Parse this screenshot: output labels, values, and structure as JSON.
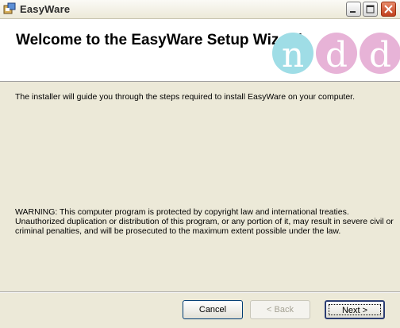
{
  "window": {
    "title": "EasyWare"
  },
  "header": {
    "title": "Welcome to the EasyWare Setup Wizard",
    "logo_letters": [
      "n",
      "d",
      "d"
    ]
  },
  "content": {
    "intro": "The installer will guide you through the steps required to install EasyWare on your computer.",
    "warning": "WARNING: This computer program is protected by copyright law and international treaties. Unauthorized duplication or distribution of this program, or any portion of it, may result in severe civil or criminal penalties, and will be prosecuted to the maximum extent possible under the law."
  },
  "buttons": {
    "cancel": "Cancel",
    "back": "< Back",
    "next": "Next >"
  },
  "colors": {
    "logo_circle_1": "#9fdde6",
    "logo_circle_2": "#e7b3d7",
    "logo_circle_3": "#e7b3d7",
    "logo_letter": "#ffffff"
  }
}
